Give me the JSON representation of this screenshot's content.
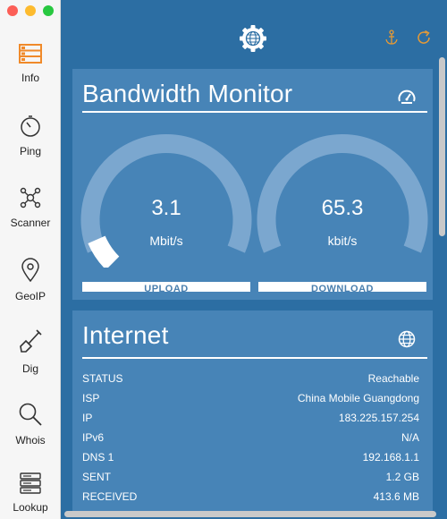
{
  "window": {
    "traffic_lights": {
      "close": "#fc5f57",
      "minimize": "#fdbb2e",
      "zoom": "#28c840"
    }
  },
  "sidebar": {
    "items": [
      {
        "label": "Info",
        "icon": "info-list-icon",
        "active": true
      },
      {
        "label": "Ping",
        "icon": "stopwatch-icon"
      },
      {
        "label": "Scanner",
        "icon": "network-nodes-icon"
      },
      {
        "label": "GeoIP",
        "icon": "location-pin-icon"
      },
      {
        "label": "Dig",
        "icon": "shovel-icon"
      },
      {
        "label": "Whois",
        "icon": "magnifier-icon"
      },
      {
        "label": "Lookup",
        "icon": "server-stack-icon"
      }
    ]
  },
  "toolbar": {
    "center_icon": "settings-globe-icon",
    "anchor_icon": "anchor-icon",
    "refresh_icon": "refresh-icon",
    "accent": "#f0a030"
  },
  "bandwidth": {
    "title": "Bandwidth Monitor",
    "title_icon": "speedometer-icon",
    "upload": {
      "value": "3.1",
      "unit": "Mbit/s",
      "label": "UPLOAD",
      "level": 0.08
    },
    "download": {
      "value": "65.3",
      "unit": "kbit/s",
      "label": "DOWNLOAD",
      "level": 0.0
    }
  },
  "internet": {
    "title": "Internet",
    "title_icon": "globe-icon",
    "rows": [
      {
        "key": "STATUS",
        "value": "Reachable"
      },
      {
        "key": "ISP",
        "value": "China Mobile Guangdong"
      },
      {
        "key": "IP",
        "value": "183.225.157.254"
      },
      {
        "key": "IPv6",
        "value": "N/A"
      },
      {
        "key": "DNS 1",
        "value": "192.168.1.1"
      },
      {
        "key": "SENT",
        "value": "1.2 GB"
      },
      {
        "key": "RECEIVED",
        "value": "413.6 MB"
      }
    ]
  }
}
